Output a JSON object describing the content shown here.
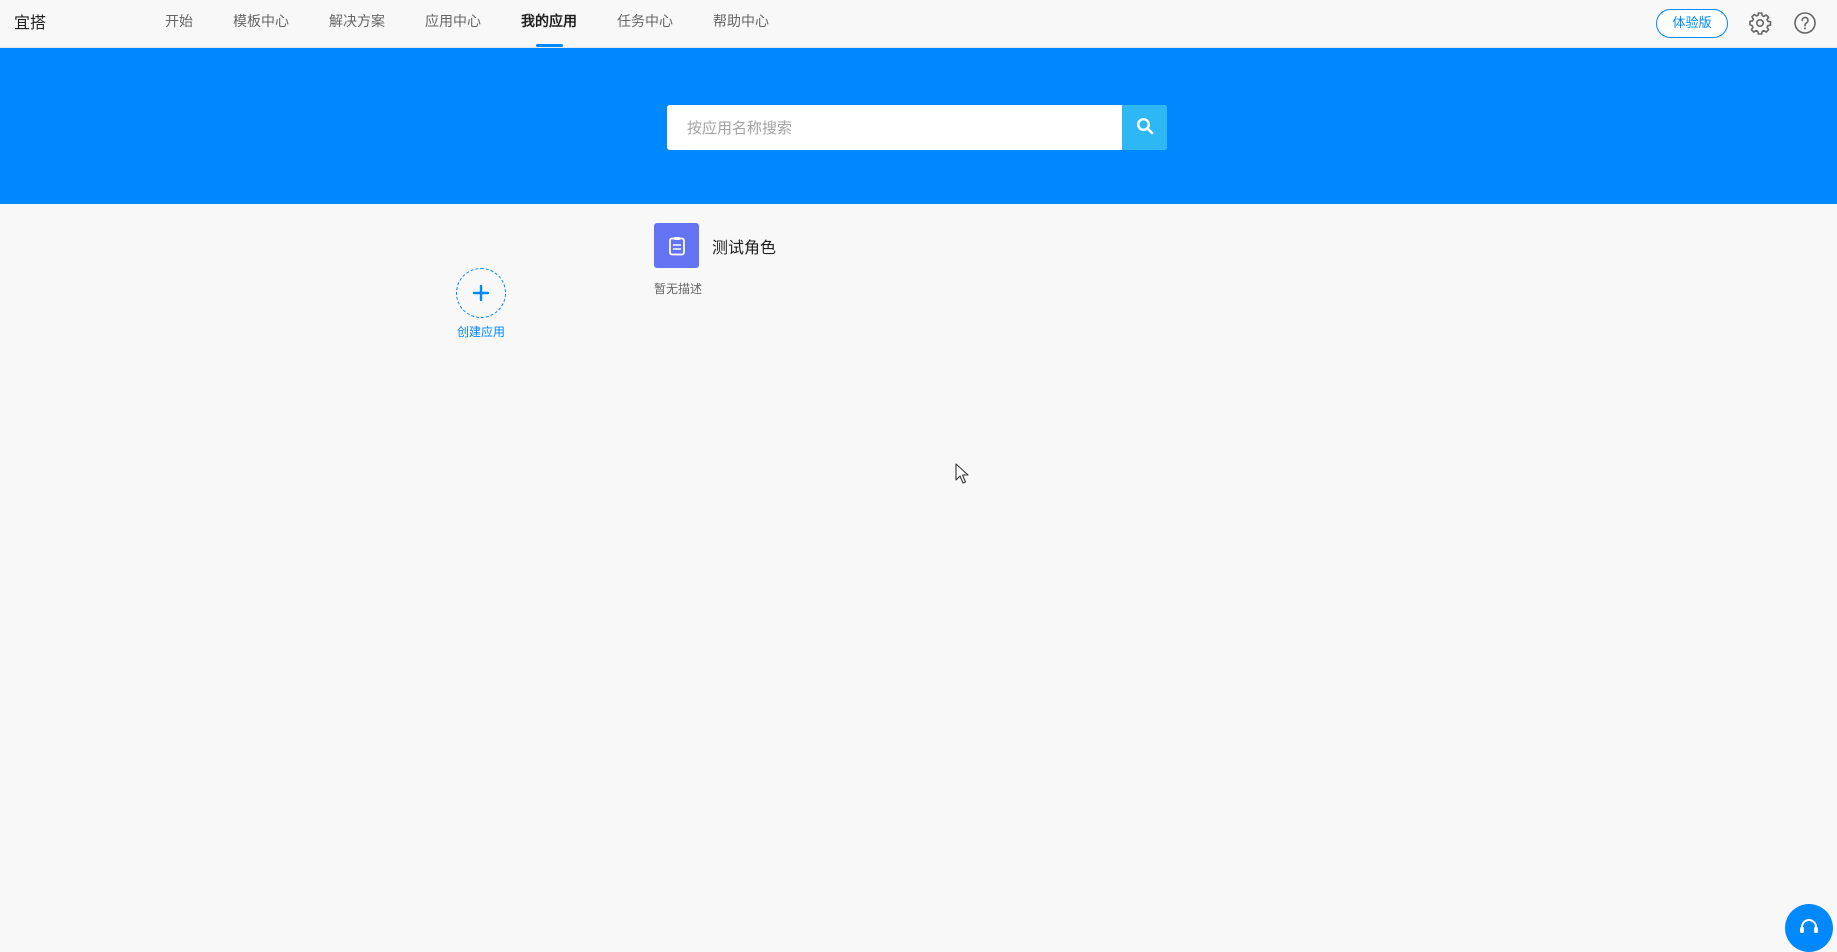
{
  "header": {
    "logo": "宜搭",
    "nav": [
      {
        "label": "开始"
      },
      {
        "label": "模板中心"
      },
      {
        "label": "解决方案"
      },
      {
        "label": "应用中心"
      },
      {
        "label": "我的应用",
        "active": true
      },
      {
        "label": "任务中心"
      },
      {
        "label": "帮助中心"
      }
    ],
    "edition_label": "体验版",
    "icons": [
      "gear-icon",
      "help-icon"
    ]
  },
  "search": {
    "placeholder": "按应用名称搜索",
    "value": "",
    "icon": "search-icon"
  },
  "create_app": {
    "label": "创建应用",
    "icon": "plus-icon"
  },
  "apps": [
    {
      "name": "测试角色",
      "description": "暂无描述",
      "icon": "clipboard-icon",
      "color": "#6373f2"
    }
  ],
  "colors": {
    "accent": "#0089ff",
    "search_button": "#2db7f5",
    "background": "#f8f8f8"
  }
}
